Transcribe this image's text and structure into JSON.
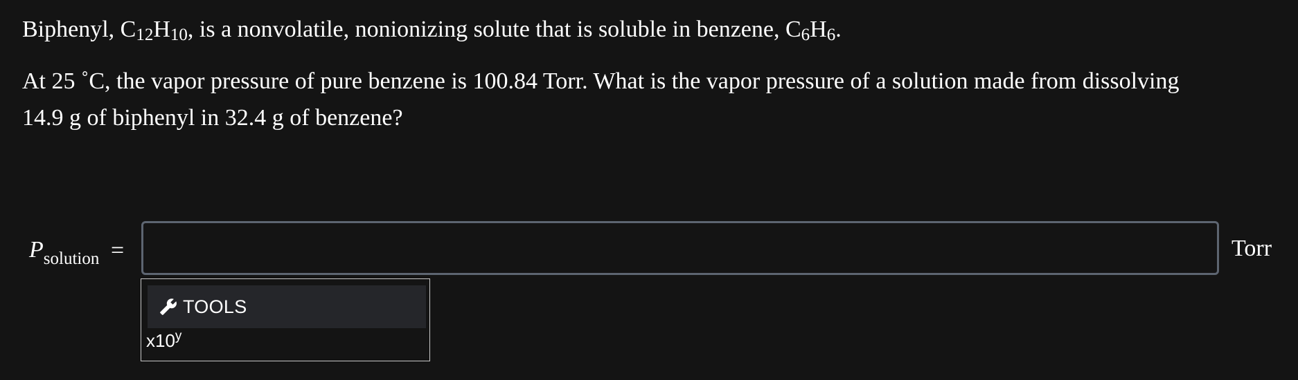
{
  "question": {
    "line1": {
      "t1": "Biphenyl, C",
      "s1": "12",
      "t2": "H",
      "s2": "10",
      "t3": ", is a nonvolatile, nonionizing solute that is soluble in benzene, C",
      "s3": "6",
      "t4": "H",
      "s4": "6",
      "t5": "."
    },
    "line2": "At 25 ˚C, the vapor pressure of pure benzene is 100.84 Torr. What is the vapor pressure of a solution made from dissolving",
    "line3": "14.9 g of biphenyl in 32.4 g of benzene?"
  },
  "answer": {
    "variable": "P",
    "subscript": "solution",
    "equals": "=",
    "value": "",
    "unit": "Torr"
  },
  "tools": {
    "icon": "wrench-icon",
    "label": "TOOLS",
    "sci_base": "x10",
    "sci_exp": "y"
  },
  "colors": {
    "background": "#141414",
    "input_border": "#5d6571",
    "tools_button_bg": "#25262a",
    "tools_panel_border": "#c8c8c8",
    "text": "#ffffff"
  }
}
